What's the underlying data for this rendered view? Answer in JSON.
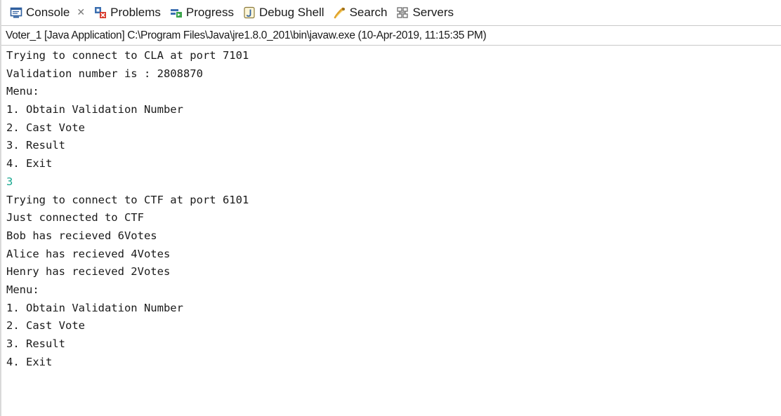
{
  "tabs": [
    {
      "label": "Console",
      "icon": "console-icon",
      "active": true,
      "close": "✕"
    },
    {
      "label": "Problems",
      "icon": "problems-icon"
    },
    {
      "label": "Progress",
      "icon": "progress-icon"
    },
    {
      "label": "Debug Shell",
      "icon": "debug-shell-icon"
    },
    {
      "label": "Search",
      "icon": "search-icon"
    },
    {
      "label": "Servers",
      "icon": "servers-icon"
    }
  ],
  "launch_info": "Voter_1 [Java Application] C:\\Program Files\\Java\\jre1.8.0_201\\bin\\javaw.exe (10-Apr-2019, 11:15:35 PM)",
  "colors": {
    "stdin_text": "#17a78f",
    "stdout_text": "#1a1a1a"
  },
  "console_lines": [
    {
      "text": "Trying to connect to CLA at port 7101"
    },
    {
      "text": "Validation number is : 2808870"
    },
    {
      "text": "Menu:"
    },
    {
      "text": "1. Obtain Validation Number"
    },
    {
      "text": "2. Cast Vote"
    },
    {
      "text": "3. Result"
    },
    {
      "text": "4. Exit"
    },
    {
      "text": "3",
      "input": true
    },
    {
      "text": "Trying to connect to CTF at port 6101"
    },
    {
      "text": "Just connected to CTF"
    },
    {
      "text": "Bob has recieved 6Votes"
    },
    {
      "text": "Alice has recieved 4Votes"
    },
    {
      "text": "Henry has recieved 2Votes"
    },
    {
      "text": "Menu:"
    },
    {
      "text": "1. Obtain Validation Number"
    },
    {
      "text": "2. Cast Vote"
    },
    {
      "text": "3. Result"
    },
    {
      "text": "4. Exit"
    }
  ]
}
